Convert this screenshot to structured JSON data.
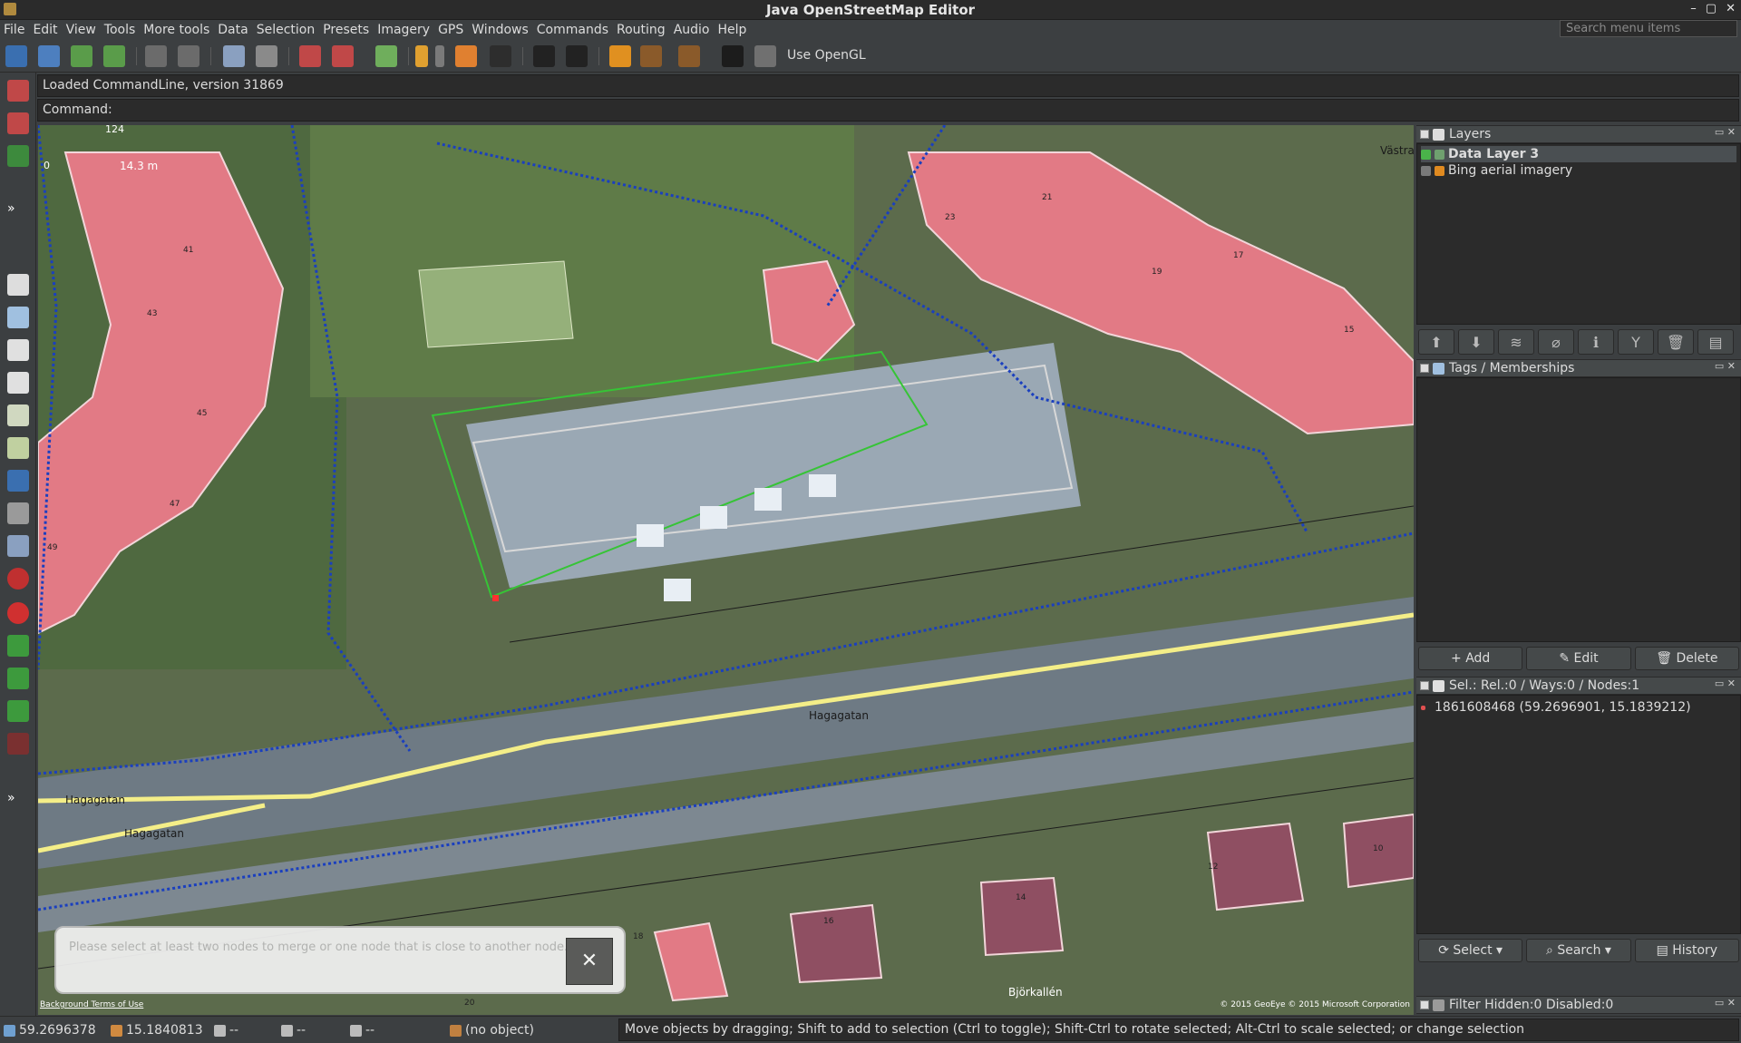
{
  "window": {
    "title": "Java OpenStreetMap Editor",
    "controls": [
      "–",
      "▢",
      "✕"
    ]
  },
  "menu": {
    "items": [
      "File",
      "Edit",
      "View",
      "Tools",
      "More tools",
      "Data",
      "Selection",
      "Presets",
      "Imagery",
      "GPS",
      "Windows",
      "Commands",
      "Routing",
      "Audio",
      "Help"
    ],
    "search_placeholder": "Search menu items"
  },
  "toolbar": {
    "opengl_label": "Use OpenGL"
  },
  "console": {
    "log_text": "Loaded CommandLine, version 31869",
    "command_label": "Command:"
  },
  "map": {
    "scale_number": "124",
    "scale_zero": "0",
    "scale_length": "14.3 m",
    "street_labels": [
      "Hagagatan",
      "Hagagatan",
      "Hagagatan",
      "Björkallén",
      "Västra Vi"
    ],
    "house_numbers": [
      "41",
      "43",
      "45",
      "47",
      "49",
      "23",
      "21",
      "19",
      "17",
      "15",
      "12",
      "10",
      "14",
      "16",
      "18",
      "20"
    ],
    "attribution_left": "Background Terms of Use",
    "attribution_right": "© 2015 GeoEye © 2015 Microsoft Corporation",
    "colors": {
      "water_way": "#1a3fbf",
      "road": "#f4ee88",
      "building": "#e27a85",
      "selection": "#e8e84a"
    }
  },
  "notice": {
    "message": "Please select at least two nodes to merge or one node that is close to another node.",
    "close_glyph": "✕"
  },
  "layers_panel": {
    "title": "Layers",
    "layers": [
      {
        "name": "Data Layer 3",
        "active": true
      },
      {
        "name": "Bing aerial imagery",
        "active": false
      }
    ]
  },
  "tags_panel": {
    "title": "Tags / Memberships",
    "add_label": "Add",
    "edit_label": "Edit",
    "delete_label": "Delete"
  },
  "selection_panel": {
    "title": "Sel.: Rel.:0 / Ways:0 / Nodes:1",
    "entries": [
      "1861608468 (59.2696901, 15.1839212)"
    ],
    "select_label": "Select",
    "search_label": "Search",
    "history_label": "History"
  },
  "filter_panel": {
    "title": "Filter Hidden:0 Disabled:0"
  },
  "status": {
    "lat": "59.2696378",
    "lon": "15.1840813",
    "heading": "--",
    "angle": "--",
    "distance": "--",
    "object": "(no object)",
    "help": "Move objects by dragging; Shift to add to selection (Ctrl to toggle); Shift-Ctrl to rotate selected; Alt-Ctrl to scale selected; or change selection"
  }
}
